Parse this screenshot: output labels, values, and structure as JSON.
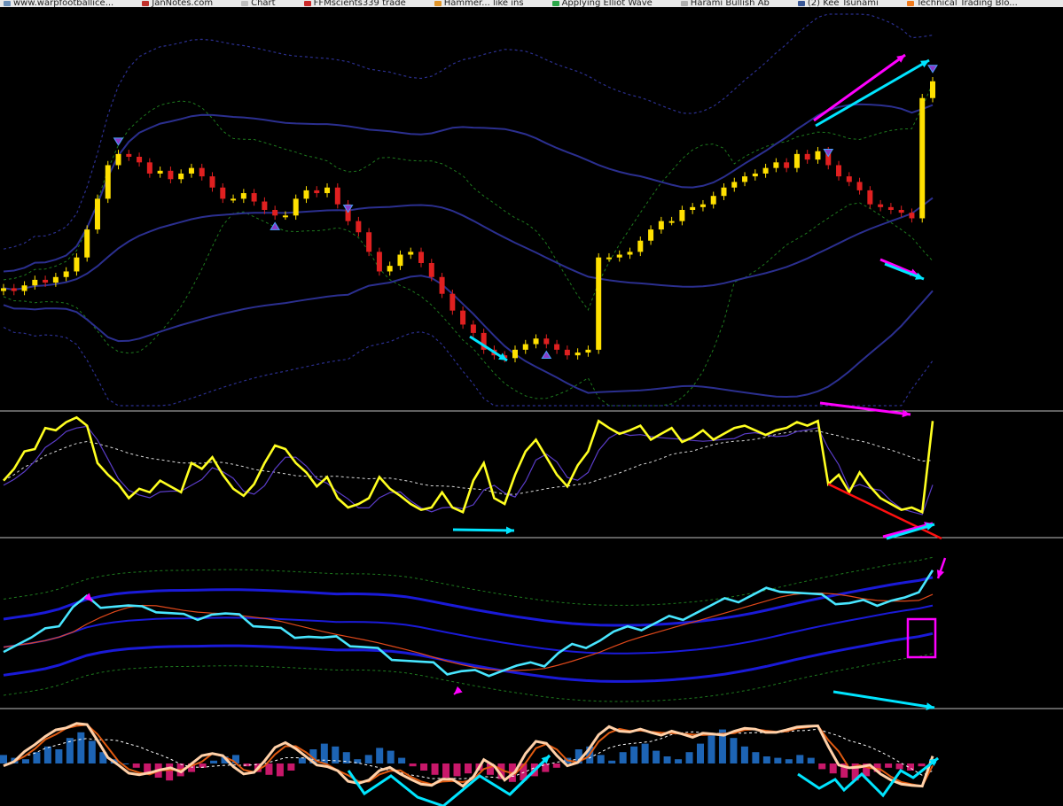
{
  "bookmarks": [
    {
      "label": "www.warpfootballice...",
      "color": "#6a8fb8"
    },
    {
      "label": "JanNotes.com",
      "color": "#c0302a"
    },
    {
      "label": "Chart",
      "color": "#bdbdbd"
    },
    {
      "label": "FFMscients339 trade",
      "color": "#cc2a2a"
    },
    {
      "label": "Hammer... like ins",
      "color": "#e0952a"
    },
    {
      "label": "Applying Elliot Wave",
      "color": "#2ca84a"
    },
    {
      "label": "Harami Bullish Ab",
      "color": "#b0b0b0"
    },
    {
      "label": "(2) Kee Tsunami",
      "color": "#3b5998"
    },
    {
      "label": "Technical Trading Blo...",
      "color": "#f07b1e"
    }
  ],
  "colors": {
    "background": "#000000",
    "bull_candle": "#ffe000",
    "bear_candle": "#e02020",
    "bollinger_dark": "#2b2f8f",
    "bollinger_dotted": "#1e7a1e",
    "divergence_magenta": "#ff00ff",
    "divergence_cyan": "#00e5ff",
    "oscillator_line": "#ffff20",
    "trend_red": "#ff1010",
    "histogram_pos": "#1d64b4",
    "histogram_neg": "#c8186a"
  },
  "chart_data": [
    {
      "type": "candlestick",
      "panel": "price",
      "series": [
        {
          "values": [
            92,
            91,
            93,
            95,
            94,
            96,
            98,
            103,
            113,
            124,
            136,
            140,
            139,
            137,
            133,
            134,
            131,
            133,
            135,
            132,
            128,
            124,
            124,
            126,
            123,
            120,
            118,
            118,
            124,
            127,
            126,
            128,
            122,
            116,
            112,
            105,
            98,
            100,
            104,
            105,
            101,
            96,
            90,
            84,
            79,
            76,
            70,
            68,
            67,
            70,
            72,
            74,
            72,
            70,
            68,
            69,
            70,
            103,
            103,
            104,
            105,
            109,
            113,
            116,
            116,
            120,
            121,
            122,
            125,
            128,
            130,
            132,
            133,
            135,
            137,
            135,
            140,
            138,
            141,
            136,
            132,
            130,
            127,
            122,
            121,
            120,
            119,
            117,
            160,
            166
          ]
        }
      ],
      "overlays": [
        "bollinger-inner",
        "bollinger-outer",
        "middle-band"
      ],
      "ylim": [
        50,
        190
      ],
      "grid": false
    },
    {
      "type": "line",
      "panel": "oscillator",
      "series": [
        {
          "values": [
            45,
            55,
            70,
            72,
            90,
            88,
            95,
            99,
            92,
            60,
            50,
            42,
            30,
            38,
            35,
            45,
            40,
            35,
            60,
            55,
            65,
            50,
            38,
            32,
            42,
            60,
            75,
            72,
            60,
            52,
            40,
            48,
            30,
            22,
            25,
            30,
            48,
            38,
            32,
            25,
            20,
            22,
            35,
            22,
            18,
            45,
            60,
            30,
            25,
            50,
            70,
            80,
            65,
            50,
            40,
            58,
            70,
            96,
            90,
            85,
            88,
            92,
            80,
            85,
            90,
            78,
            82,
            88,
            80,
            85,
            90,
            92,
            88,
            84,
            88,
            90,
            95,
            92,
            96,
            42,
            50,
            35,
            52,
            40,
            30,
            25,
            20,
            22,
            18,
            96
          ]
        }
      ],
      "ylim": [
        0,
        100
      ],
      "grid": false
    },
    {
      "type": "line",
      "panel": "rsi-bands",
      "series": [
        {
          "values": [
            48,
            50,
            52,
            55,
            60,
            68,
            72,
            70,
            69,
            68,
            66,
            67,
            65,
            63,
            64,
            65,
            64,
            62,
            60,
            58,
            56,
            55,
            54,
            52,
            51,
            50,
            48,
            46,
            44,
            42,
            40,
            38,
            36,
            36,
            35,
            36,
            37,
            38,
            38,
            40,
            45,
            48,
            50,
            52,
            55,
            56,
            58,
            60,
            62,
            64,
            66,
            68,
            70,
            72,
            74,
            76,
            78,
            76,
            74,
            72,
            71,
            70,
            70,
            71,
            72,
            72,
            73,
            88
          ]
        }
      ],
      "ylim": [
        20,
        100
      ],
      "grid": false
    },
    {
      "type": "bar",
      "panel": "macd",
      "series": [
        {
          "values": [
            6,
            4,
            3,
            8,
            12,
            10,
            18,
            22,
            16,
            8,
            3,
            0,
            -3,
            -7,
            -10,
            -12,
            -9,
            -6,
            -3,
            2,
            5,
            6,
            -2,
            -6,
            -8,
            -9,
            -5,
            4,
            10,
            14,
            12,
            8,
            3,
            6,
            11,
            9,
            4,
            -2,
            -5,
            -8,
            -10,
            -9,
            -7,
            -5,
            -8,
            -11,
            -13,
            -12,
            -9,
            -6,
            -3,
            4,
            10,
            12,
            6,
            2,
            8,
            12,
            14,
            9,
            5,
            3,
            8,
            14,
            20,
            24,
            18,
            12,
            8,
            5,
            4,
            3,
            6,
            4,
            -4,
            -7,
            -10,
            -12,
            -9,
            -6,
            -3,
            -4,
            -5,
            -2,
            3
          ]
        }
      ],
      "ylim": [
        -25,
        25
      ],
      "grid": false
    }
  ]
}
